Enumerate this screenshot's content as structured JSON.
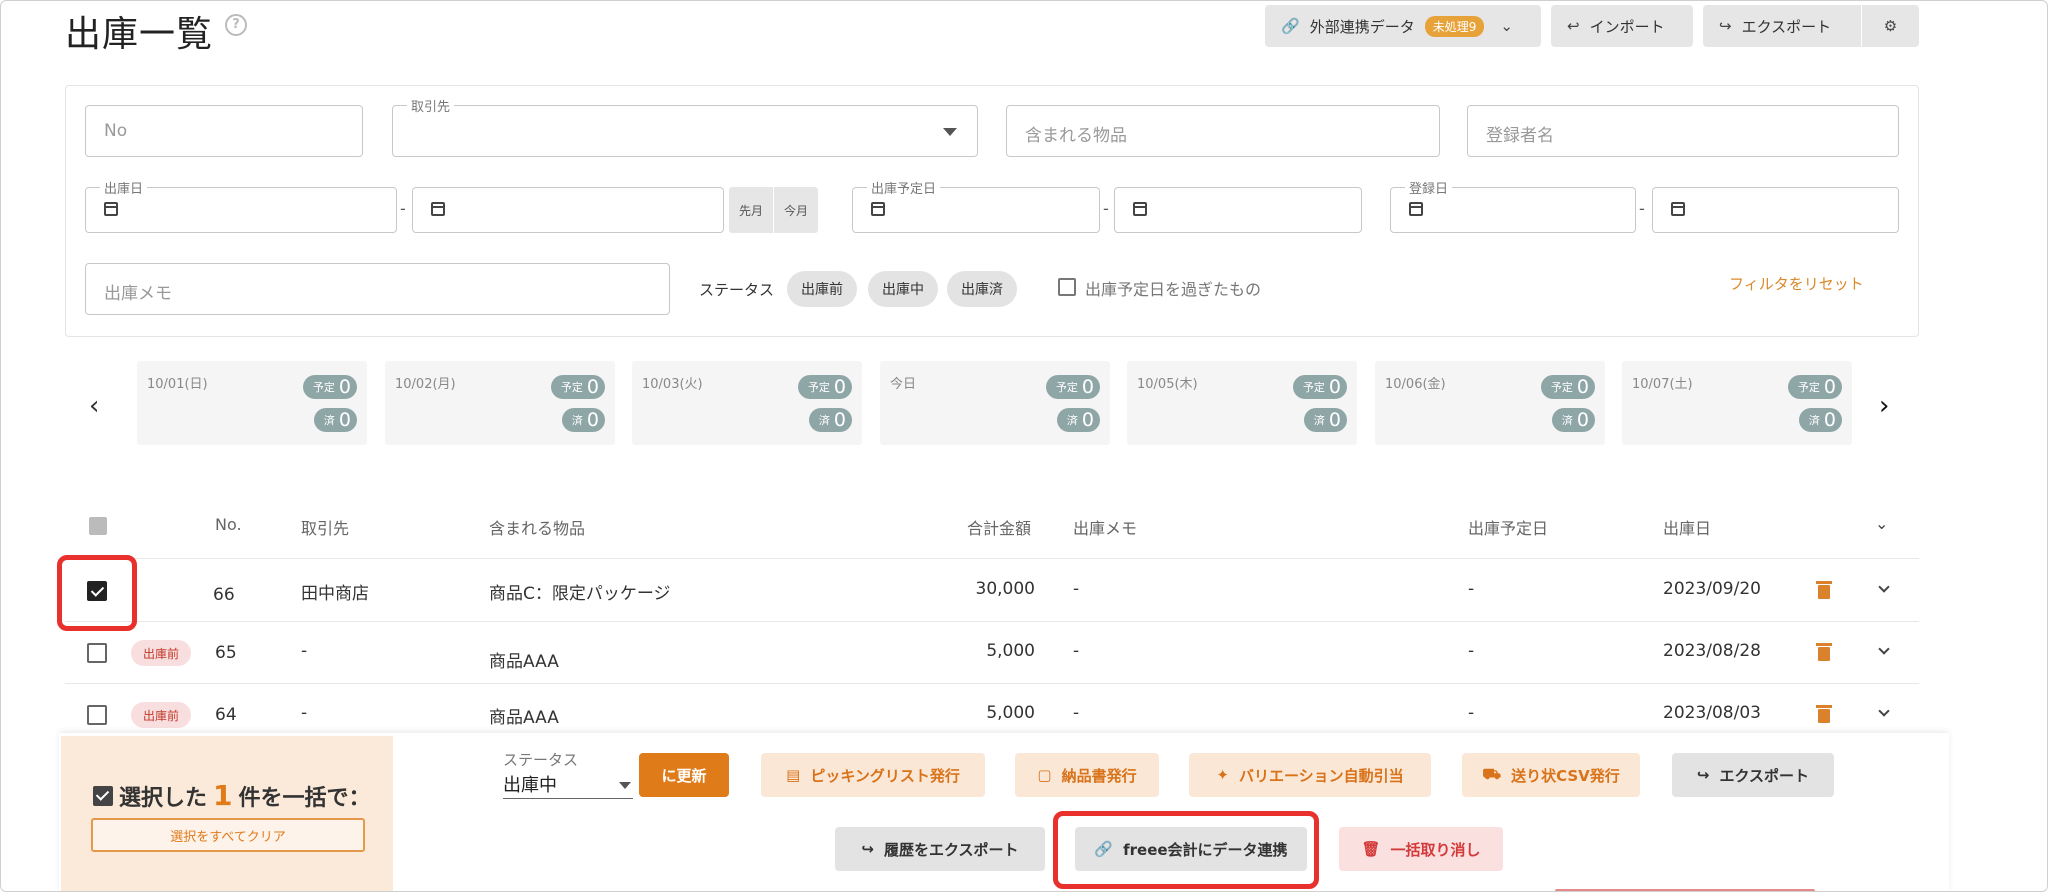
{
  "page": {
    "title": "出庫一覧",
    "help_icon": "?"
  },
  "top_actions": {
    "integration_label": "外部連携データ",
    "integration_badge": "未処理9",
    "import_label": "インポート",
    "export_label": "エクスポート"
  },
  "filters": {
    "no_placeholder": "No",
    "partner_label": "取引先",
    "items_placeholder": "含まれる物品",
    "registrant_placeholder": "登録者名",
    "ship_date_label": "出庫日",
    "last_month": "先月",
    "this_month": "今月",
    "planned_date_label": "出庫予定日",
    "registered_date_label": "登録日",
    "memo_placeholder": "出庫メモ",
    "status_label": "ステータス",
    "status_chips": [
      "出庫前",
      "出庫中",
      "出庫済"
    ],
    "overdue_label": "出庫予定日を過ぎたもの",
    "reset_label": "フィルタをリセット",
    "range_dash": "-"
  },
  "calendar": {
    "planned_key": "予定",
    "done_key": "済",
    "days": [
      {
        "label": "10/01(日)",
        "planned": "0",
        "done": "0"
      },
      {
        "label": "10/02(月)",
        "planned": "0",
        "done": "0"
      },
      {
        "label": "10/03(火)",
        "planned": "0",
        "done": "0"
      },
      {
        "label": "今日",
        "planned": "0",
        "done": "0"
      },
      {
        "label": "10/05(木)",
        "planned": "0",
        "done": "0"
      },
      {
        "label": "10/06(金)",
        "planned": "0",
        "done": "0"
      },
      {
        "label": "10/07(土)",
        "planned": "0",
        "done": "0"
      }
    ]
  },
  "table": {
    "headers": {
      "no": "No.",
      "partner": "取引先",
      "items": "含まれる物品",
      "total": "合計金額",
      "memo": "出庫メモ",
      "planned": "出庫予定日",
      "ship_date": "出庫日"
    },
    "rows": [
      {
        "checked": true,
        "status": "",
        "no": "66",
        "partner": "田中商店",
        "items": "商品C：限定パッケージ",
        "total": "30,000",
        "memo": "-",
        "planned": "-",
        "ship_date": "2023/09/20"
      },
      {
        "checked": false,
        "status": "出庫前",
        "no": "65",
        "partner": "-",
        "items": "商品AAA",
        "total": "5,000",
        "memo": "-",
        "planned": "-",
        "ship_date": "2023/08/28"
      },
      {
        "checked": false,
        "status": "出庫前",
        "no": "64",
        "partner": "-",
        "items": "商品AAA",
        "total": "5,000",
        "memo": "-",
        "planned": "-",
        "ship_date": "2023/08/03"
      }
    ]
  },
  "bulk": {
    "prefix": "選択した",
    "count": "1",
    "suffix": "件を一括で：",
    "clear_label": "選択をすべてクリア",
    "status_label": "ステータス",
    "status_value": "出庫中",
    "update_label": "に更新",
    "picking_label": "ピッキングリスト発行",
    "delivery_label": "納品書発行",
    "variation_label": "バリエーション自動引当",
    "shipping_csv_label": "送り状CSV発行",
    "export_label": "エクスポート",
    "history_export_label": "履歴をエクスポート",
    "freee_label": "freee会計にデータ連携",
    "cancel_label": "一括取り消し"
  },
  "colors": {
    "accent": "#e07b1a",
    "highlight": "#e8312c",
    "pill": "#8fa6a7"
  }
}
